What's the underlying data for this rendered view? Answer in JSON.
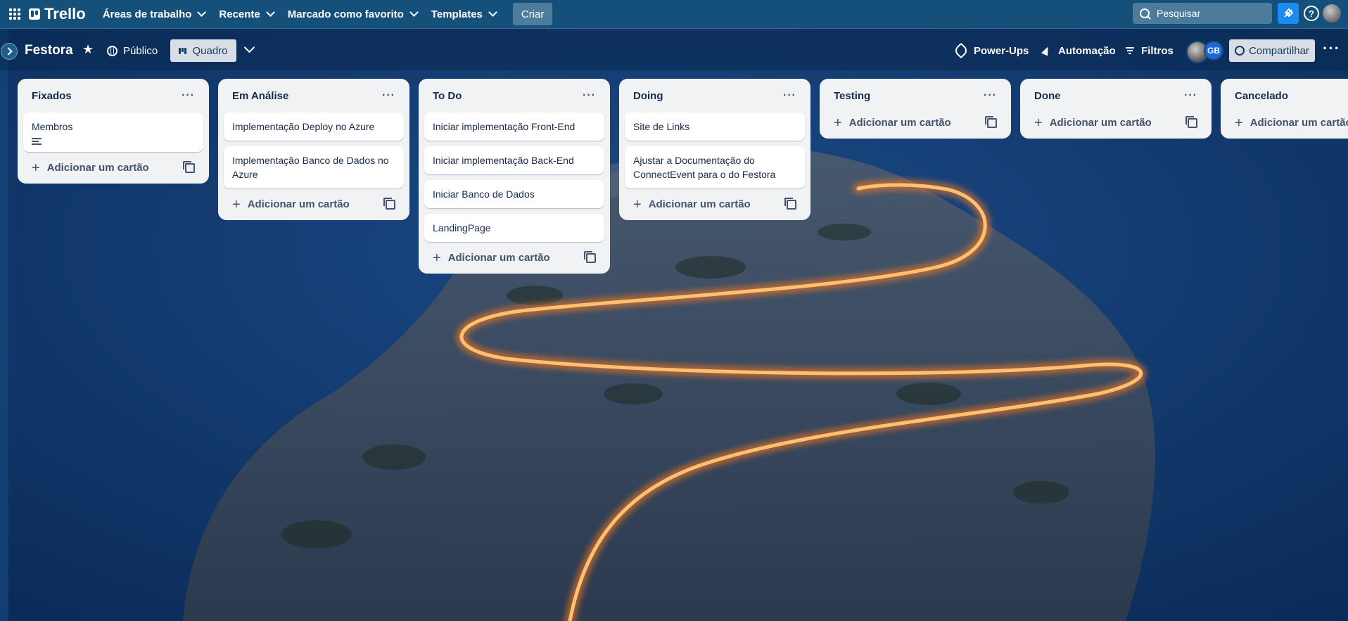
{
  "topbar": {
    "logo": "Trello",
    "nav": [
      {
        "label": "Áreas de trabalho"
      },
      {
        "label": "Recente"
      },
      {
        "label": "Marcado como favorito"
      },
      {
        "label": "Templates"
      }
    ],
    "create_label": "Criar",
    "search_placeholder": "Pesquisar",
    "help_label": "?"
  },
  "board": {
    "title": "Festora",
    "visibility": "Público",
    "view": "Quadro",
    "tools": {
      "powerups": "Power-Ups",
      "automation": "Automação",
      "filters": "Filtros"
    },
    "member_initials": "GB",
    "share_label": "Compartilhar",
    "more_label": "···"
  },
  "add_card_label": "Adicionar um cartão",
  "lists": [
    {
      "title": "Fixados",
      "cards": [
        "Membros"
      ]
    },
    {
      "title": "Em Análise",
      "cards": [
        "Implementação Deploy no Azure",
        "Implementação Banco de Dados no Azure"
      ]
    },
    {
      "title": "To Do",
      "cards": [
        "Iniciar implementação Front-End",
        "Iniciar implementação Back-End",
        "Iniciar Banco de Dados",
        "LandingPage"
      ]
    },
    {
      "title": "Doing",
      "cards": [
        "Site de Links",
        "Ajustar a Documentação do ConnectEvent para o do Festora"
      ]
    },
    {
      "title": "Testing",
      "cards": []
    },
    {
      "title": "Done",
      "cards": []
    },
    {
      "title": "Cancelado",
      "cards": []
    }
  ],
  "colors": {
    "header": "#15507a",
    "list_bg": "#f1f2f4",
    "accent": "#1c8af0",
    "light_trail": "#ff8a2a"
  }
}
